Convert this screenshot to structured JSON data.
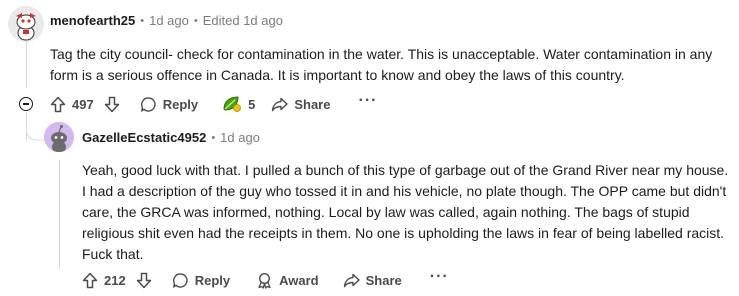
{
  "comment": {
    "username": "menofearth25",
    "time": "1d ago",
    "edited": "Edited 1d ago",
    "body_line1": "Tag the city council- check for contamination in the water. This is unacceptable. Water contamination in any",
    "body_line2": "form is a serious offence in Canada. It is important to know and obey the laws of this country.",
    "upvotes": "497",
    "reply_label": "Reply",
    "award_count": "5",
    "share_label": "Share",
    "more_label": "···"
  },
  "reply": {
    "username": "GazelleEcstatic4952",
    "time": "1d ago",
    "body_lines": [
      "Yeah, good luck with that. I pulled a bunch of this type of garbage out of the Grand River near my house.",
      "I had a description of the guy who tossed it in and his vehicle, no plate though. The OPP came but didn't",
      "care, the GRCA was informed, nothing. Local by law was called, again nothing. The bags of stupid",
      "religious shit even had the receipts in them. No one is upholding the laws in fear of being labelled racist.",
      "Fuck that."
    ],
    "upvotes": "212",
    "reply_label": "Reply",
    "award_label": "Award",
    "share_label": "Share",
    "more_label": "···"
  },
  "icons": {
    "upvote": "arrow-up-icon",
    "downvote": "arrow-down-icon",
    "reply": "speech-bubble-icon",
    "award": "award-icon",
    "share": "share-arrow-icon",
    "collapse": "collapse-minus-icon",
    "award_emoji": "leaf-sticker-icon"
  },
  "colors": {
    "reply_avatar_bg": "#d4b8f0",
    "award_green": "#46a508"
  }
}
